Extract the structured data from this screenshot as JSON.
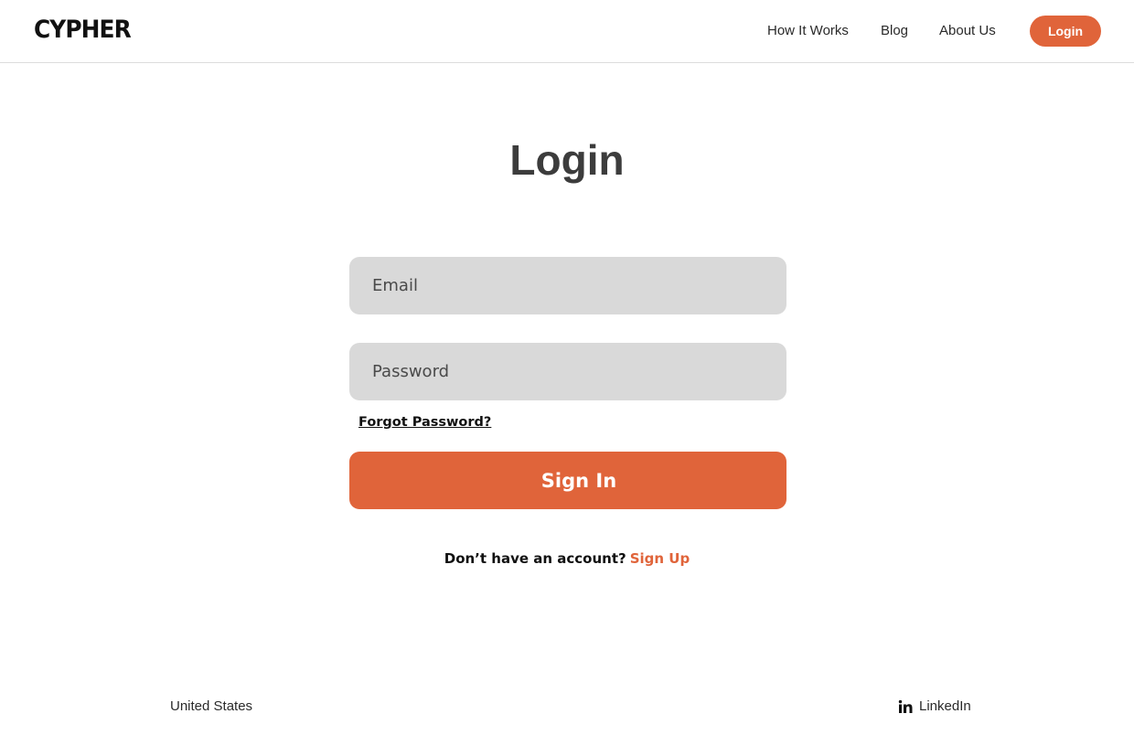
{
  "header": {
    "logo": "CYPHER",
    "nav": {
      "how_it_works": "How It Works",
      "blog": "Blog",
      "about_us": "About Us",
      "login_button": "Login"
    }
  },
  "main": {
    "title": "Login",
    "email": {
      "placeholder": "Email",
      "value": ""
    },
    "password": {
      "placeholder": "Password",
      "value": ""
    },
    "forgot_password": "Forgot Password?",
    "sign_in_button": "Sign In",
    "signup_prompt": "Don’t have an account?",
    "signup_link": "Sign Up"
  },
  "footer": {
    "country": "United States",
    "linkedin": "LinkedIn",
    "linkedin_icon": "linkedin-icon"
  },
  "colors": {
    "accent": "#e0643a",
    "field_bg": "#d9d9d9",
    "title": "#3c3c3c"
  }
}
